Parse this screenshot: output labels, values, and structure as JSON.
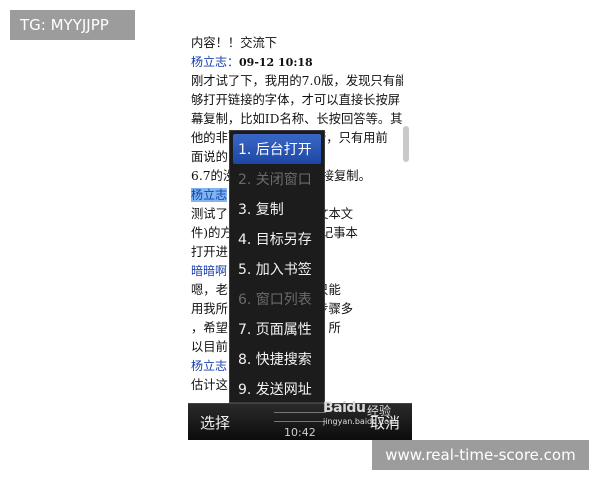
{
  "watermarks": {
    "top_left": "TG: MYYJJPP",
    "bottom_right": "www.real-time-score.com"
  },
  "article": {
    "lines": [
      {
        "text": "内容！！交流下"
      },
      {
        "author": "杨立志：",
        "date": "09-12 10:18"
      },
      {
        "text": "刚才试了下，我用的7.0版，发现只有能"
      },
      {
        "text": "够打开链接的字体，才可以直接长按屏"
      },
      {
        "text": "幕复制，比如ID名称、长按回答等。其"
      },
      {
        "text": "他的非可打开的文字不行，只有用前"
      },
      {
        "text": "面说的"
      },
      {
        "text": "6.7的没                   直接复制。"
      },
      {
        "author_hl": "杨立志"
      },
      {
        "text": "测试了          非网页（文本文"
      },
      {
        "text": "件)的方          文件夹用记事本"
      },
      {
        "text": "打开进          是如此了。"
      },
      {
        "author": "暗暗啊"
      },
      {
        "text": "嗯，老          有版本都只能"
      },
      {
        "text": "用我所          是麻烦，步骤多"
      },
      {
        "text": "，希望          工程浩大，所"
      },
      {
        "text": "以目前"
      },
      {
        "author": "杨立志"
      },
      {
        "text": "估计这"
      },
      {
        "text": "--------------------------------",
        "dash": true
      }
    ]
  },
  "menu": {
    "items": [
      {
        "label": "1. 后台打开",
        "state": "selected"
      },
      {
        "label": "2. 关闭窗口",
        "state": "disabled"
      },
      {
        "label": "3. 复制",
        "state": "normal"
      },
      {
        "label": "4. 目标另存",
        "state": "normal"
      },
      {
        "label": "5. 加入书签",
        "state": "normal"
      },
      {
        "label": "6. 窗口列表",
        "state": "disabled"
      },
      {
        "label": "7. 页面属性",
        "state": "normal"
      },
      {
        "label": "8. 快捷搜索",
        "state": "normal"
      },
      {
        "label": "9. 发送网址",
        "state": "normal"
      }
    ]
  },
  "softkeys": {
    "left": "选择",
    "right": "取消",
    "clock": "10:42"
  },
  "logo": {
    "brand": "Baidu",
    "product": "经验",
    "site": "jingyan.baidu.com"
  }
}
